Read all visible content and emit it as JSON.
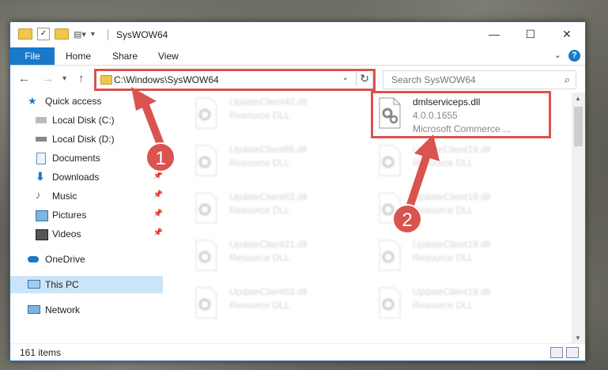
{
  "window": {
    "title": "SysWOW64"
  },
  "ribbon": {
    "file": "File",
    "home": "Home",
    "share": "Share",
    "view": "View",
    "help": "?"
  },
  "address": {
    "path": "C:\\Windows\\SysWOW64"
  },
  "search": {
    "placeholder": "Search SysWOW64"
  },
  "sidebar": {
    "items": [
      {
        "label": "Quick access"
      },
      {
        "label": "Local Disk (C:)"
      },
      {
        "label": "Local Disk (D:)"
      },
      {
        "label": "Documents"
      },
      {
        "label": "Downloads"
      },
      {
        "label": "Music"
      },
      {
        "label": "Pictures"
      },
      {
        "label": "Videos"
      },
      {
        "label": "OneDrive"
      },
      {
        "label": "This PC"
      },
      {
        "label": "Network"
      }
    ]
  },
  "files": {
    "highlight": {
      "name": "dmlserviceps.dll",
      "version": "4.0.0.1655",
      "company": "Microsoft Commerce ..."
    },
    "left": [
      {
        "name": "UpdateClient42.dll",
        "type": "Resource DLL"
      },
      {
        "name": "UpdateClient65.dll",
        "type": "Resource DLL"
      },
      {
        "name": "UpdateClient63.dll",
        "type": "Resource DLL"
      },
      {
        "name": "UpdateClient21.dll",
        "type": "Resource DLL"
      },
      {
        "name": "UpdateClient63.dll",
        "type": "Resource DLL"
      }
    ],
    "right": [
      {
        "name": "UpdateClient19.dll",
        "type": "Resource DLL"
      },
      {
        "name": "UpdateClient19.dll",
        "type": "Resource DLL"
      },
      {
        "name": "UpdateClient19.dll",
        "type": "Resource DLL"
      },
      {
        "name": "UpdateClient19.dll",
        "type": "Resource DLL"
      }
    ]
  },
  "status": {
    "count": "161 items"
  },
  "annotations": {
    "step1": "1",
    "step2": "2"
  },
  "colors": {
    "accent": "#1979ca",
    "highlight": "#d9534f",
    "selected": "#cce4f7"
  }
}
